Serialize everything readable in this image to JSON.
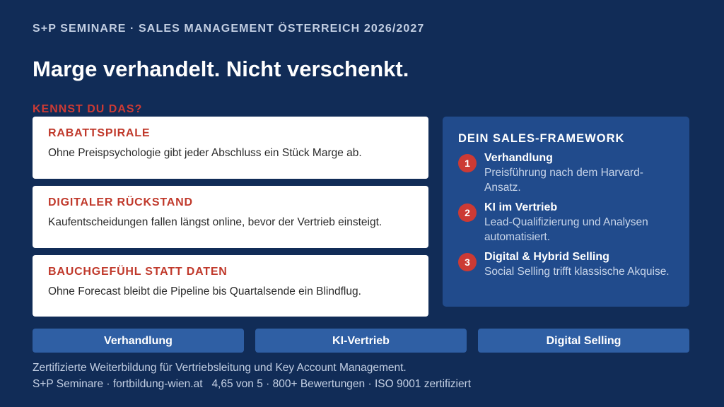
{
  "header": {
    "overline": "S+P SEMINARE · SALES MANAGEMENT ÖSTERREICH 2026/2027",
    "headline": "Marge verhandelt. Nicht verschenkt."
  },
  "problems": {
    "label": "KENNST DU DAS?",
    "cards": [
      {
        "title": "RABATTSPIRALE",
        "text": "Ohne Preispsychologie gibt jeder Abschluss ein Stück Marge ab."
      },
      {
        "title": "DIGITALER RÜCKSTAND",
        "text": "Kaufentscheidungen fallen längst online, bevor der Vertrieb einsteigt."
      },
      {
        "title": "BAUCHGEFÜHL STATT DATEN",
        "text": "Ohne Forecast bleibt die Pipeline bis Quartalsende ein Blindflug."
      }
    ]
  },
  "framework": {
    "title": "DEIN SALES-FRAMEWORK",
    "steps": [
      {
        "num": "1",
        "title": "Verhandlung",
        "text": "Preisführung nach dem Harvard-Ansatz."
      },
      {
        "num": "2",
        "title": "KI im Vertrieb",
        "text": "Lead-Qualifizierung und Analysen automatisiert."
      },
      {
        "num": "3",
        "title": "Digital & Hybrid Selling",
        "text": "Social Selling trifft klassische Akquise."
      }
    ]
  },
  "tabs": [
    "Verhandlung",
    "KI-Vertrieb",
    "Digital Selling"
  ],
  "footer": {
    "line1": "Zertifizierte Weiterbildung für Vertriebsleitung und Key Account Management.",
    "line2": "S+P Seminare · fortbildung-wien.at   4,65 von 5 · 800+ Bewertungen · ISO 9001 zertifiziert"
  },
  "colors": {
    "background": "#112c57",
    "panel": "#214b8c",
    "accent_red": "#cc3a34",
    "button": "#2f5fa4"
  }
}
